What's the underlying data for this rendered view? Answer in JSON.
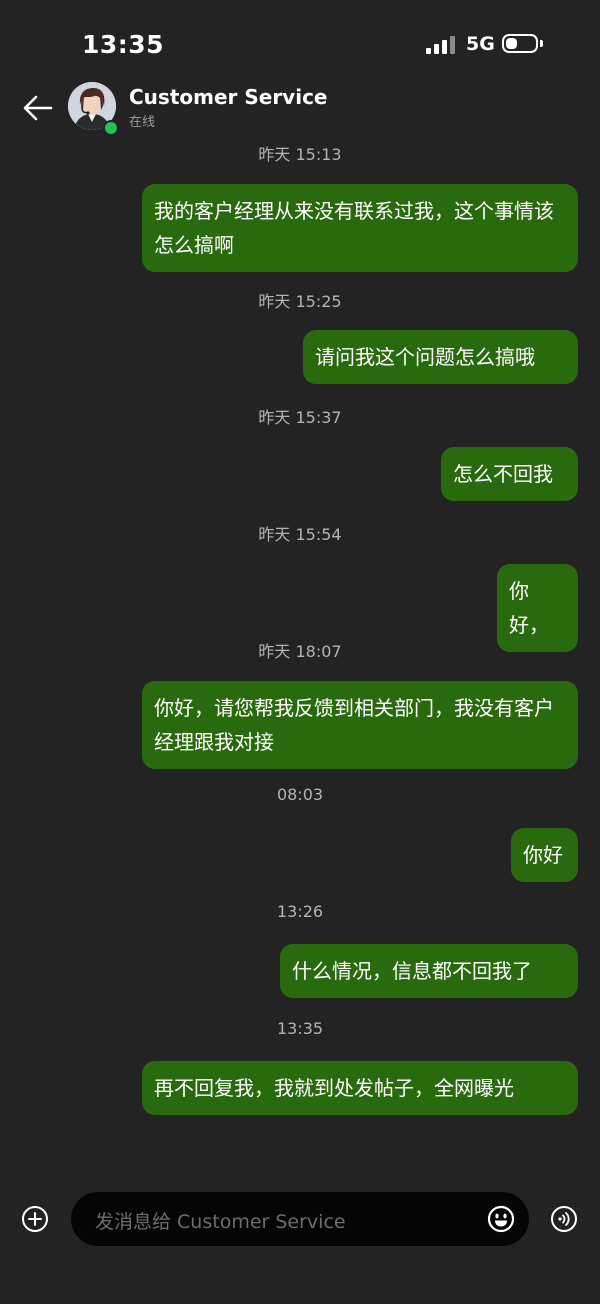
{
  "status_bar": {
    "time": "13:35",
    "network": "5G",
    "signal_bars": 4,
    "battery_fraction": 0.4
  },
  "header": {
    "back_icon": "arrow-left-icon",
    "contact_name": "Customer Service",
    "contact_status": "在线",
    "online_color": "#22c15b"
  },
  "messages": [
    {
      "timestamp": "昨天 15:13",
      "text": "我的客户经理从来没有联系过我，这个事情该怎么搞啊"
    },
    {
      "timestamp": "昨天 15:25",
      "text": "请问我这个问题怎么搞哦"
    },
    {
      "timestamp": "昨天 15:37",
      "text": "怎么不回我"
    },
    {
      "timestamp": "昨天 15:54",
      "text": "你好，"
    },
    {
      "timestamp": "昨天 18:07",
      "text": "你好，请您帮我反馈到相关部门，我没有客户经理跟我对接"
    },
    {
      "timestamp": "08:03",
      "text": "你好"
    },
    {
      "timestamp": "13:26",
      "text": "什么情况，信息都不回我了"
    },
    {
      "timestamp": "13:35",
      "text": "再不回复我，我就到处发帖子，全网曝光"
    }
  ],
  "composer": {
    "placeholder": "发消息给 Customer Service",
    "plus_icon": "plus-circle-icon",
    "emoji_icon": "emoji-icon",
    "voice_icon": "voice-icon"
  },
  "colors": {
    "background": "#232323",
    "bubble": "#2a6a0e",
    "input": "#050505"
  }
}
